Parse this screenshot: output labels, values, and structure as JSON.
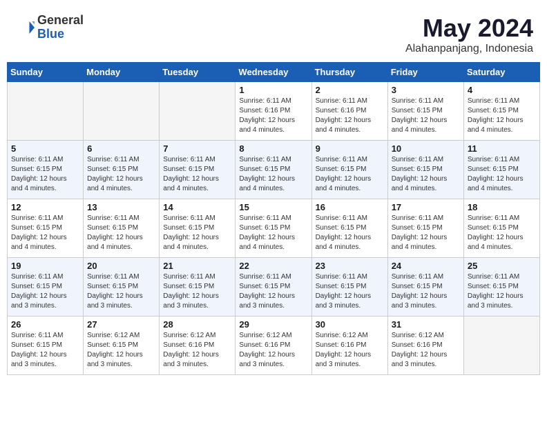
{
  "logo": {
    "general": "General",
    "blue": "Blue"
  },
  "title": "May 2024",
  "subtitle": "Alahanpanjang, Indonesia",
  "weekdays": [
    "Sunday",
    "Monday",
    "Tuesday",
    "Wednesday",
    "Thursday",
    "Friday",
    "Saturday"
  ],
  "weeks": [
    [
      {
        "day": "",
        "empty": true
      },
      {
        "day": "",
        "empty": true
      },
      {
        "day": "",
        "empty": true
      },
      {
        "day": "1",
        "sunrise": "6:11 AM",
        "sunset": "6:16 PM",
        "daylight": "12 hours and 4 minutes."
      },
      {
        "day": "2",
        "sunrise": "6:11 AM",
        "sunset": "6:16 PM",
        "daylight": "12 hours and 4 minutes."
      },
      {
        "day": "3",
        "sunrise": "6:11 AM",
        "sunset": "6:15 PM",
        "daylight": "12 hours and 4 minutes."
      },
      {
        "day": "4",
        "sunrise": "6:11 AM",
        "sunset": "6:15 PM",
        "daylight": "12 hours and 4 minutes."
      }
    ],
    [
      {
        "day": "5",
        "sunrise": "6:11 AM",
        "sunset": "6:15 PM",
        "daylight": "12 hours and 4 minutes."
      },
      {
        "day": "6",
        "sunrise": "6:11 AM",
        "sunset": "6:15 PM",
        "daylight": "12 hours and 4 minutes."
      },
      {
        "day": "7",
        "sunrise": "6:11 AM",
        "sunset": "6:15 PM",
        "daylight": "12 hours and 4 minutes."
      },
      {
        "day": "8",
        "sunrise": "6:11 AM",
        "sunset": "6:15 PM",
        "daylight": "12 hours and 4 minutes."
      },
      {
        "day": "9",
        "sunrise": "6:11 AM",
        "sunset": "6:15 PM",
        "daylight": "12 hours and 4 minutes."
      },
      {
        "day": "10",
        "sunrise": "6:11 AM",
        "sunset": "6:15 PM",
        "daylight": "12 hours and 4 minutes."
      },
      {
        "day": "11",
        "sunrise": "6:11 AM",
        "sunset": "6:15 PM",
        "daylight": "12 hours and 4 minutes."
      }
    ],
    [
      {
        "day": "12",
        "sunrise": "6:11 AM",
        "sunset": "6:15 PM",
        "daylight": "12 hours and 4 minutes."
      },
      {
        "day": "13",
        "sunrise": "6:11 AM",
        "sunset": "6:15 PM",
        "daylight": "12 hours and 4 minutes."
      },
      {
        "day": "14",
        "sunrise": "6:11 AM",
        "sunset": "6:15 PM",
        "daylight": "12 hours and 4 minutes."
      },
      {
        "day": "15",
        "sunrise": "6:11 AM",
        "sunset": "6:15 PM",
        "daylight": "12 hours and 4 minutes."
      },
      {
        "day": "16",
        "sunrise": "6:11 AM",
        "sunset": "6:15 PM",
        "daylight": "12 hours and 4 minutes."
      },
      {
        "day": "17",
        "sunrise": "6:11 AM",
        "sunset": "6:15 PM",
        "daylight": "12 hours and 4 minutes."
      },
      {
        "day": "18",
        "sunrise": "6:11 AM",
        "sunset": "6:15 PM",
        "daylight": "12 hours and 4 minutes."
      }
    ],
    [
      {
        "day": "19",
        "sunrise": "6:11 AM",
        "sunset": "6:15 PM",
        "daylight": "12 hours and 3 minutes."
      },
      {
        "day": "20",
        "sunrise": "6:11 AM",
        "sunset": "6:15 PM",
        "daylight": "12 hours and 3 minutes."
      },
      {
        "day": "21",
        "sunrise": "6:11 AM",
        "sunset": "6:15 PM",
        "daylight": "12 hours and 3 minutes."
      },
      {
        "day": "22",
        "sunrise": "6:11 AM",
        "sunset": "6:15 PM",
        "daylight": "12 hours and 3 minutes."
      },
      {
        "day": "23",
        "sunrise": "6:11 AM",
        "sunset": "6:15 PM",
        "daylight": "12 hours and 3 minutes."
      },
      {
        "day": "24",
        "sunrise": "6:11 AM",
        "sunset": "6:15 PM",
        "daylight": "12 hours and 3 minutes."
      },
      {
        "day": "25",
        "sunrise": "6:11 AM",
        "sunset": "6:15 PM",
        "daylight": "12 hours and 3 minutes."
      }
    ],
    [
      {
        "day": "26",
        "sunrise": "6:11 AM",
        "sunset": "6:15 PM",
        "daylight": "12 hours and 3 minutes."
      },
      {
        "day": "27",
        "sunrise": "6:12 AM",
        "sunset": "6:15 PM",
        "daylight": "12 hours and 3 minutes."
      },
      {
        "day": "28",
        "sunrise": "6:12 AM",
        "sunset": "6:16 PM",
        "daylight": "12 hours and 3 minutes."
      },
      {
        "day": "29",
        "sunrise": "6:12 AM",
        "sunset": "6:16 PM",
        "daylight": "12 hours and 3 minutes."
      },
      {
        "day": "30",
        "sunrise": "6:12 AM",
        "sunset": "6:16 PM",
        "daylight": "12 hours and 3 minutes."
      },
      {
        "day": "31",
        "sunrise": "6:12 AM",
        "sunset": "6:16 PM",
        "daylight": "12 hours and 3 minutes."
      },
      {
        "day": "",
        "empty": true
      }
    ]
  ],
  "labels": {
    "sunrise": "Sunrise:",
    "sunset": "Sunset:",
    "daylight": "Daylight hours"
  }
}
